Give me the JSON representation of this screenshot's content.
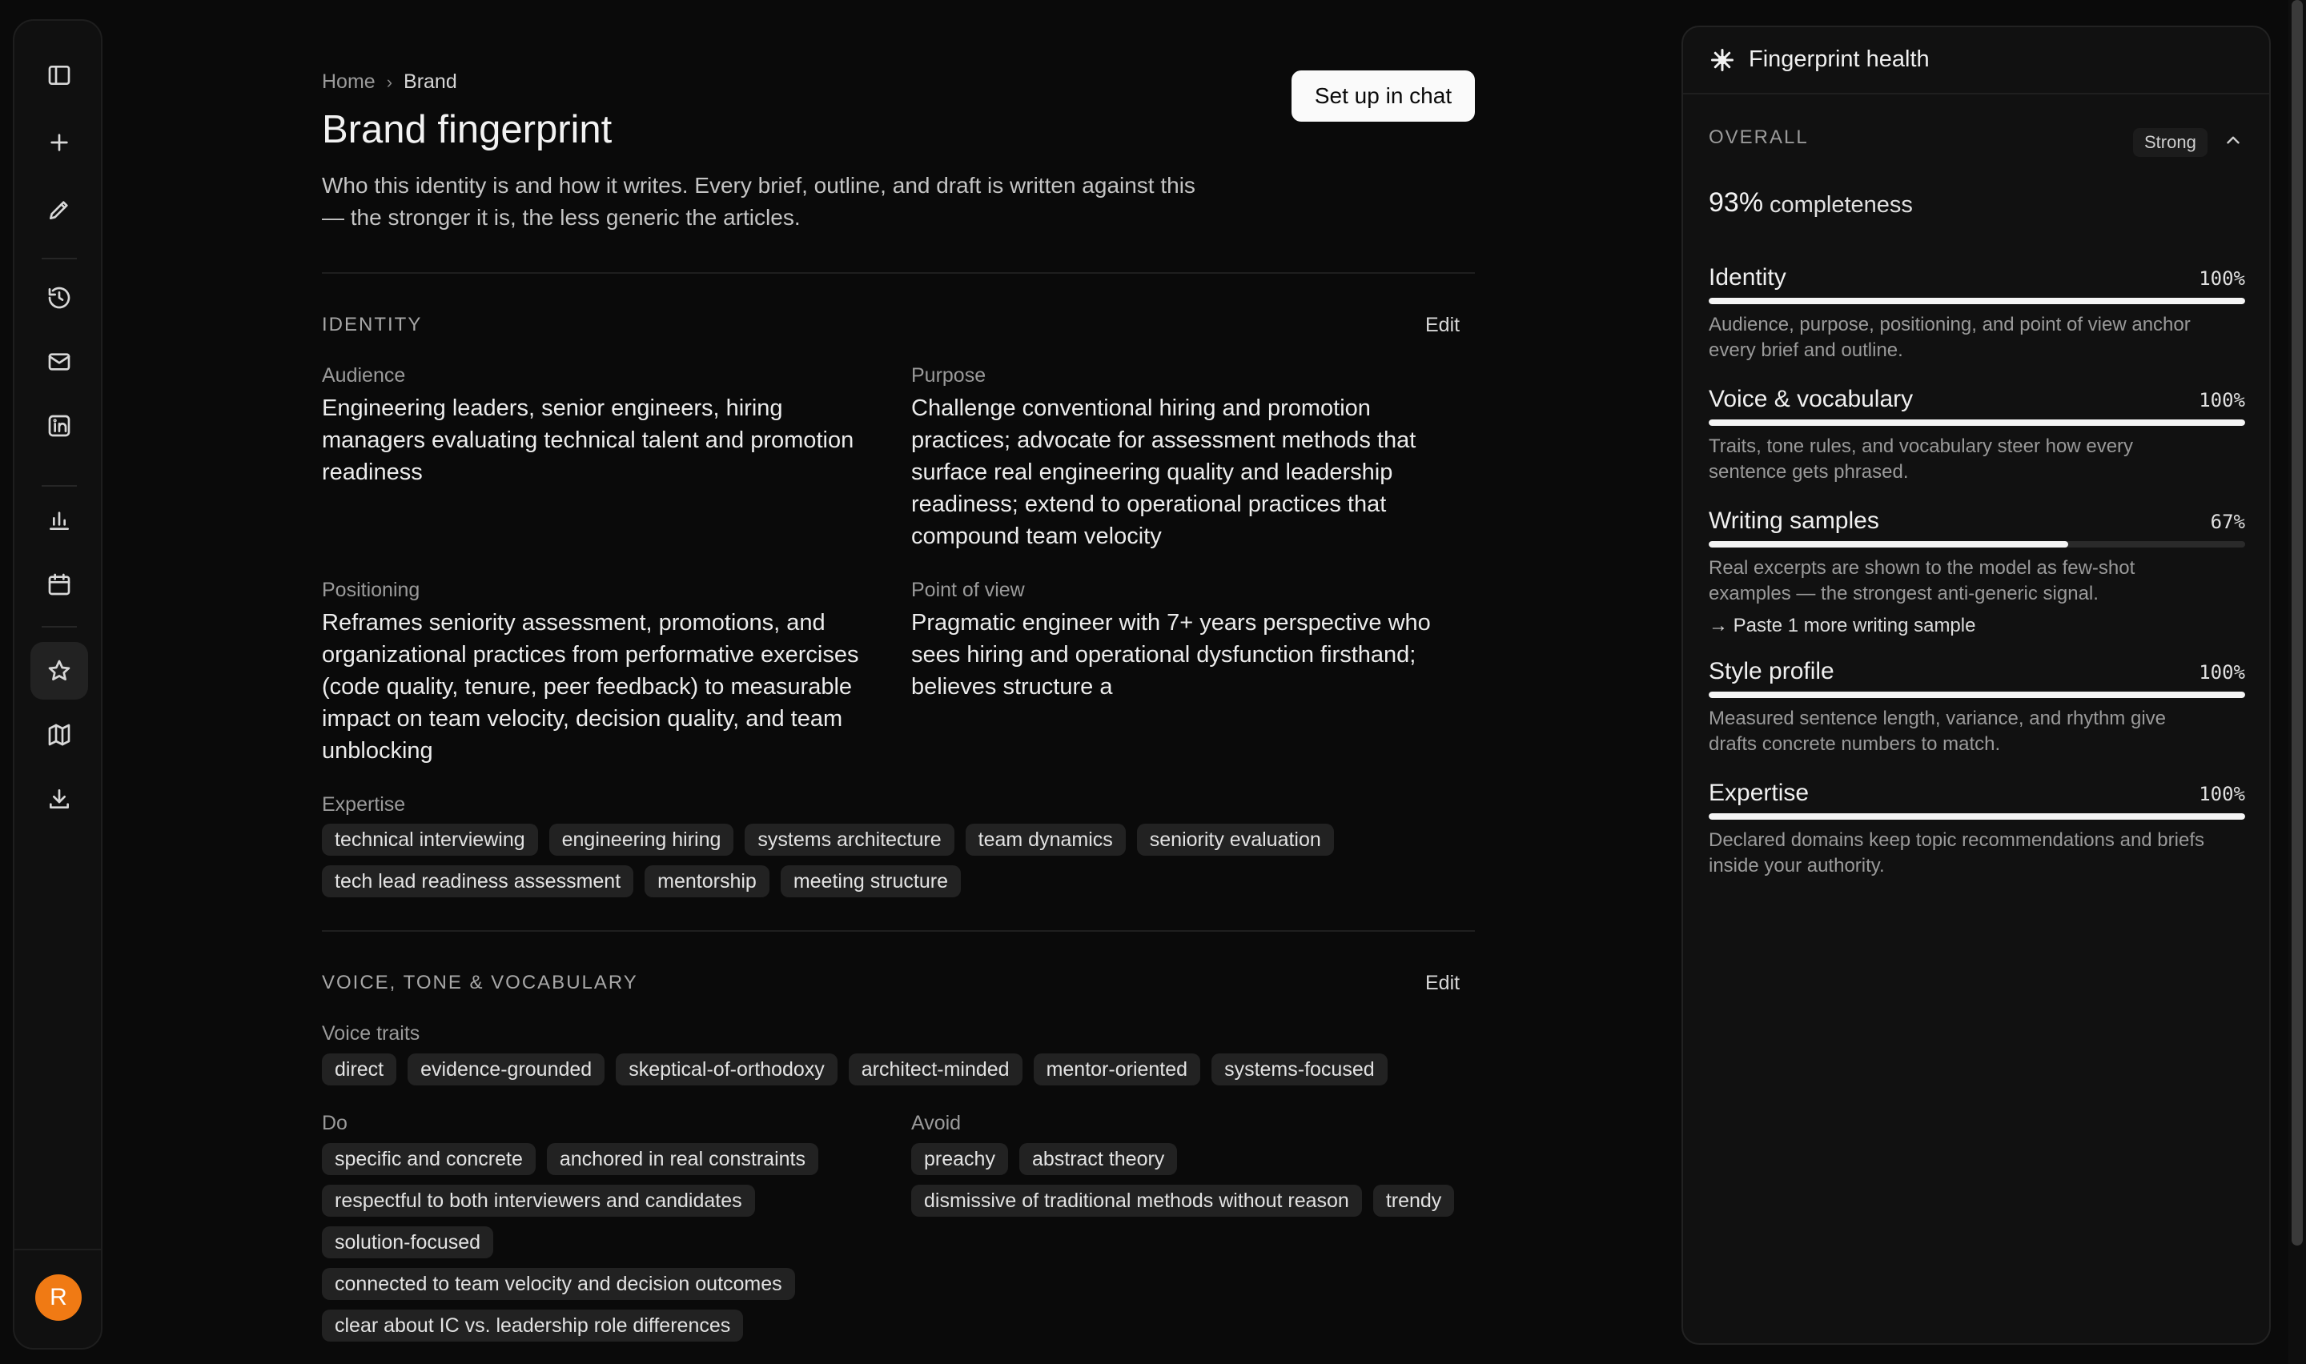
{
  "breadcrumb": {
    "home": "Home",
    "separator": "›",
    "current": "Brand"
  },
  "page": {
    "title": "Brand fingerprint",
    "subtitle_line1": "Who this identity is and how it writes. Every brief, outline, and draft is written against this",
    "subtitle_line2": "— the stronger it is, the less generic the articles.",
    "setup_button": "Set up in chat"
  },
  "sidebar": {
    "icons": [
      "sidebar-toggle-icon",
      "plus-icon",
      "pencil-icon",
      "history-icon",
      "mail-icon",
      "linkedin-icon",
      "bar-chart-icon",
      "calendar-icon",
      "star-icon",
      "map-icon",
      "download-icon"
    ],
    "active": "star-icon",
    "avatar_initial": "R",
    "avatar_color": "#f07a14"
  },
  "identity": {
    "section_title": "IDENTITY",
    "edit_label": "Edit",
    "audience_label": "Audience",
    "audience": "Engineering leaders, senior engineers, hiring managers evaluating technical talent and promotion readiness",
    "purpose_label": "Purpose",
    "purpose": "Challenge conventional hiring and promotion practices; advocate for assessment methods that surface real engineering quality and leadership readiness; extend to operational practices that compound team velocity",
    "positioning_label": "Positioning",
    "positioning": "Reframes seniority assessment, promotions, and organizational practices from performative exercises (code quality, tenure, peer feedback) to measurable impact on team velocity, decision quality, and team unblocking",
    "pov_label": "Point of view",
    "pov": "Pragmatic engineer with 7+ years perspective who sees hiring and operational dysfunction firsthand; believes structure a",
    "expertise_label": "Expertise",
    "expertise": [
      "technical interviewing",
      "engineering hiring",
      "systems architecture",
      "team dynamics",
      "seniority evaluation",
      "tech lead readiness assessment",
      "mentorship",
      "meeting structure"
    ]
  },
  "voice": {
    "section_title": "VOICE, TONE & VOCABULARY",
    "edit_label": "Edit",
    "traits_label": "Voice traits",
    "traits": [
      "direct",
      "evidence-grounded",
      "skeptical-of-orthodoxy",
      "architect-minded",
      "mentor-oriented",
      "systems-focused"
    ],
    "do_label": "Do",
    "do": [
      "specific and concrete",
      "anchored in real constraints",
      "respectful to both interviewers and candidates",
      "solution-focused",
      "connected to team velocity and decision outcomes",
      "clear about IC vs. leadership role differences"
    ],
    "avoid_label": "Avoid",
    "avoid": [
      "preachy",
      "abstract theory",
      "dismissive of traditional methods without reason",
      "trendy"
    ]
  },
  "health": {
    "title": "Fingerprint health",
    "overall_label": "OVERALL",
    "badge": "Strong",
    "overall_pct": "93%",
    "overall_word": "completeness",
    "metrics": [
      {
        "name": "Identity",
        "pct_label": "100%",
        "fill": 1.0,
        "desc1": "Audience, purpose, positioning, and point of view anchor",
        "desc2": "every brief and outline."
      },
      {
        "name": "Voice & vocabulary",
        "pct_label": "100%",
        "fill": 1.0,
        "desc1": "Traits, tone rules, and vocabulary steer how every",
        "desc2": "sentence gets phrased."
      },
      {
        "name": "Writing samples",
        "pct_label": "67%",
        "fill": 0.67,
        "desc1": "Real excerpts are shown to the model as few-shot",
        "desc2": "examples — the strongest anti-generic signal.",
        "hint": "→ Paste 1 more writing sample"
      },
      {
        "name": "Style profile",
        "pct_label": "100%",
        "fill": 1.0,
        "desc1": "Measured sentence length, variance, and rhythm give",
        "desc2": "drafts concrete numbers to match."
      },
      {
        "name": "Expertise",
        "pct_label": "100%",
        "fill": 1.0,
        "desc1": "Declared domains keep topic recommendations and briefs",
        "desc2": "inside your authority."
      }
    ]
  }
}
